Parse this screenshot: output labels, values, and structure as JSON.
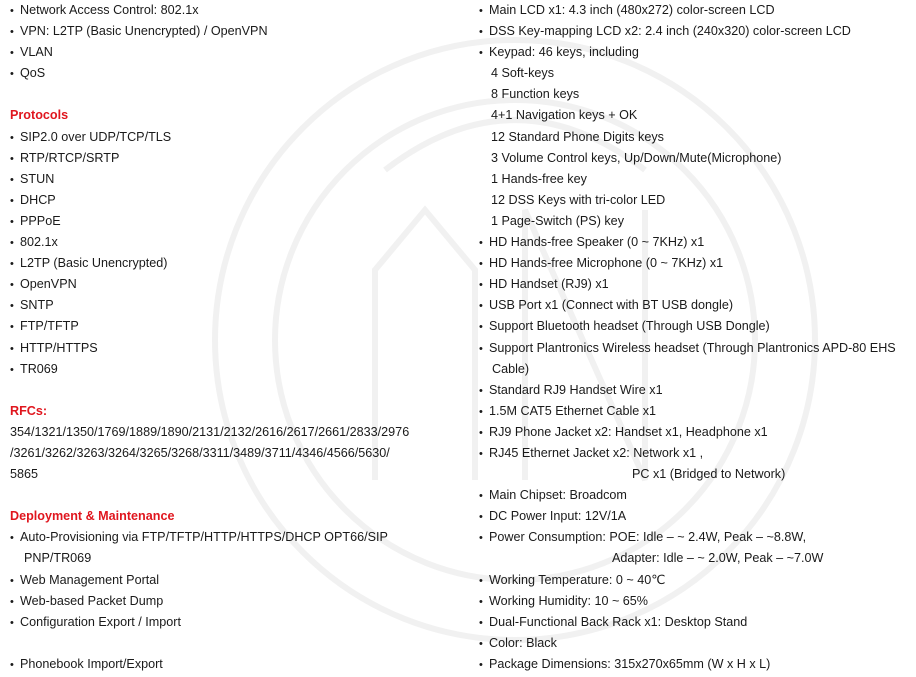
{
  "left_column": {
    "network_items": [
      "Network Access Control: 802.1x",
      "VPN: L2TP (Basic Unencrypted) / OpenVPN",
      "VLAN",
      "QoS"
    ],
    "protocols": {
      "heading": "Protocols",
      "items": [
        "SIP2.0 over UDP/TCP/TLS",
        "RTP/RTCP/SRTP",
        "STUN",
        "DHCP",
        "PPPoE",
        "802.1x",
        "L2TP (Basic Unencrypted)",
        "OpenVPN",
        "SNTP",
        "FTP/TFTP",
        "HTTP/HTTPS",
        "TR069"
      ]
    },
    "rfcs": {
      "heading": "RFCs:",
      "lines": [
        "354/1321/1350/1769/1889/1890/2131/2132/2616/2617/2661/2833/2976",
        "/3261/3262/3263/3264/3265/3268/3311/3489/3711/4346/4566/5630/",
        "5865"
      ]
    },
    "deployment": {
      "heading": "Deployment & Maintenance",
      "auto_provisioning": "Auto-Provisioning via FTP/TFTP/HTTP/HTTPS/DHCP OPT66/SIP",
      "auto_provisioning_cont": "PNP/TR069",
      "items": [
        "Web Management Portal",
        "Web-based Packet Dump",
        "Configuration Export / Import"
      ],
      "phonebook": "Phonebook Import/Export"
    }
  },
  "right_column": {
    "main_lcd": "Main LCD x1: 4.3 inch (480x272) color-screen LCD",
    "dss_lcd": "DSS Key-mapping LCD x2: 2.4 inch (240x320) color-screen LCD",
    "keypad": "Keypad: 46 keys, including",
    "keypad_items": [
      "4 Soft-keys",
      "8 Function keys",
      "4+1 Navigation keys + OK",
      "12 Standard Phone Digits keys",
      "3 Volume Control keys, Up/Down/Mute(Microphone)",
      "1 Hands-free key",
      "12 DSS Keys with tri-color LED",
      "1 Page-Switch (PS) key"
    ],
    "hardware_items": [
      "HD Hands-free Speaker (0 ~ 7KHz) x1",
      "HD Hands-free Microphone (0 ~ 7KHz) x1",
      "HD Handset (RJ9) x1",
      "USB Port x1 (Connect with BT USB dongle)",
      "Support Bluetooth headset (Through USB Dongle)"
    ],
    "plantronics": "Support Plantronics Wireless headset (Through Plantronics APD-80 EHS",
    "plantronics_cont": "Cable)",
    "accessory_items": [
      "Standard RJ9 Handset Wire x1",
      "1.5M CAT5 Ethernet Cable x1",
      "RJ9 Phone Jacket x2: Handset x1, Headphone x1"
    ],
    "rj45": "RJ45 Ethernet Jacket x2: Network x1 ,",
    "rj45_cont": "PC x1 (Bridged to Network)",
    "chipset": "Main Chipset: Broadcom",
    "dc_power": "DC Power Input: 12V/1A",
    "power_consumption": "Power Consumption: POE: Idle – ~ 2.4W, Peak – ~8.8W,",
    "power_consumption_cont": "Adapter: Idle – ~ 2.0W, Peak – ~7.0W",
    "final_items": [
      "Working Temperature: 0 ~ 40℃",
      "Working Humidity: 10 ~ 65%",
      "Dual-Functional Back Rack x1: Desktop Stand",
      "Color: Black",
      "Package Dimensions: 315x270x65mm (W x H x L)"
    ]
  },
  "colors": {
    "heading": "#e0161e",
    "text": "#1a1a1a",
    "background": "#ffffff"
  }
}
